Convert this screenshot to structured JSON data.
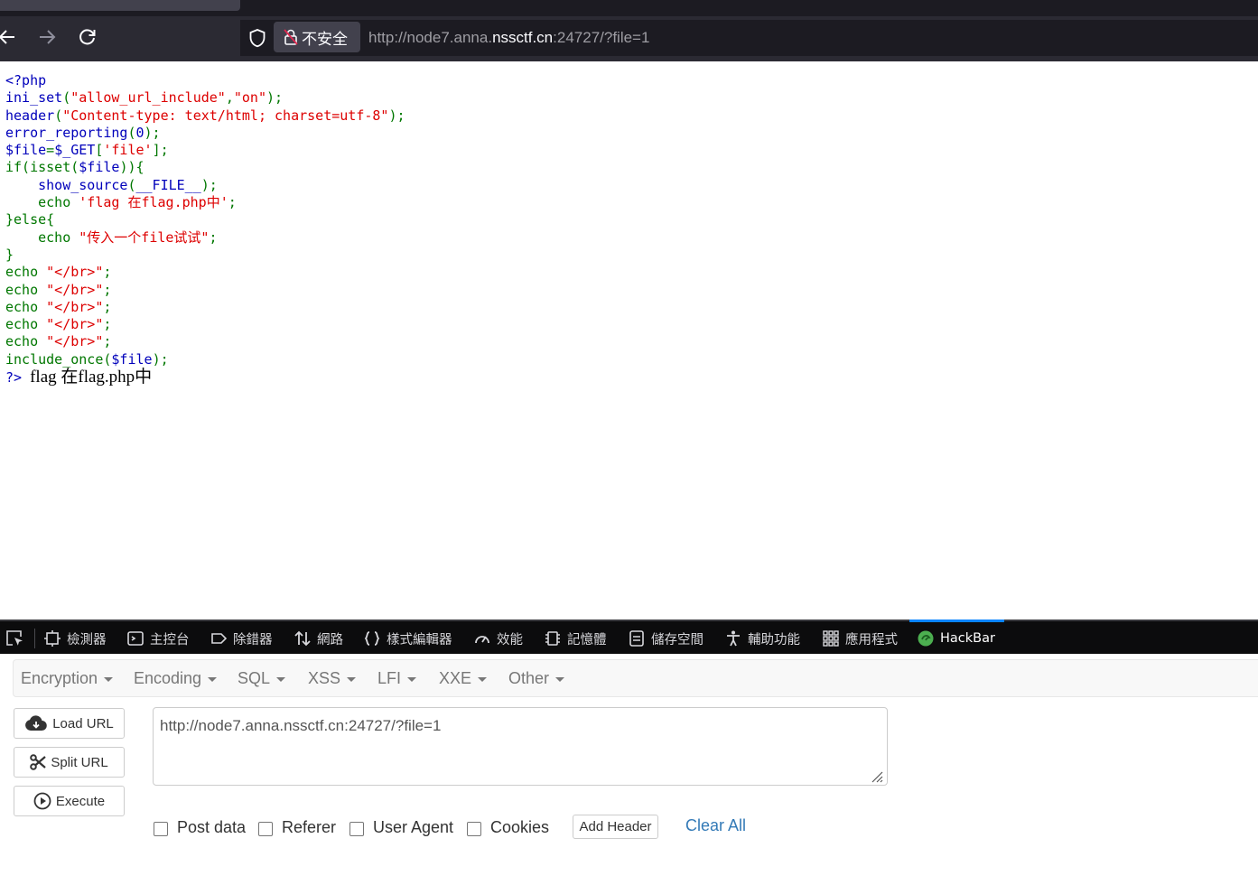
{
  "browser": {
    "security_label": "不安全",
    "url_prefix": "http://node7.anna.",
    "url_host": "nssctf.cn",
    "url_suffix": ":24727/?file=1"
  },
  "source": {
    "lines": [
      [
        {
          "t": "<?php",
          "c": "k"
        }
      ],
      [
        {
          "t": "ini_set",
          "c": "k"
        },
        {
          "t": "(",
          "c": "g"
        },
        {
          "t": "\"allow_url_include\"",
          "c": "r"
        },
        {
          "t": ",",
          "c": "g"
        },
        {
          "t": "\"on\"",
          "c": "r"
        },
        {
          "t": ");",
          "c": "g"
        }
      ],
      [
        {
          "t": "header",
          "c": "k"
        },
        {
          "t": "(",
          "c": "g"
        },
        {
          "t": "\"Content-type: text/html; charset=utf-8\"",
          "c": "r"
        },
        {
          "t": ");",
          "c": "g"
        }
      ],
      [
        {
          "t": "error_reporting",
          "c": "k"
        },
        {
          "t": "(",
          "c": "g"
        },
        {
          "t": "0",
          "c": "k"
        },
        {
          "t": ");",
          "c": "g"
        }
      ],
      [
        {
          "t": "$file",
          "c": "k"
        },
        {
          "t": "=",
          "c": "g"
        },
        {
          "t": "$_GET",
          "c": "k"
        },
        {
          "t": "[",
          "c": "g"
        },
        {
          "t": "'file'",
          "c": "r"
        },
        {
          "t": "];",
          "c": "g"
        }
      ],
      [
        {
          "t": "if(isset(",
          "c": "g"
        },
        {
          "t": "$file",
          "c": "k"
        },
        {
          "t": ")){",
          "c": "g"
        }
      ],
      [
        {
          "t": "    ",
          "c": "g"
        },
        {
          "t": "show_source",
          "c": "k"
        },
        {
          "t": "(",
          "c": "g"
        },
        {
          "t": "__FILE__",
          "c": "k"
        },
        {
          "t": ");",
          "c": "g"
        }
      ],
      [
        {
          "t": "    echo ",
          "c": "g"
        },
        {
          "t": "'flag 在flag.php中'",
          "c": "r"
        },
        {
          "t": ";",
          "c": "g"
        }
      ],
      [
        {
          "t": "}else{",
          "c": "g"
        }
      ],
      [
        {
          "t": "    echo ",
          "c": "g"
        },
        {
          "t": "\"传入一个file试试\"",
          "c": "r"
        },
        {
          "t": ";",
          "c": "g"
        }
      ],
      [
        {
          "t": "}",
          "c": "g"
        }
      ],
      [
        {
          "t": "echo ",
          "c": "g"
        },
        {
          "t": "\"</br>\"",
          "c": "r"
        },
        {
          "t": ";",
          "c": "g"
        }
      ],
      [
        {
          "t": "echo ",
          "c": "g"
        },
        {
          "t": "\"</br>\"",
          "c": "r"
        },
        {
          "t": ";",
          "c": "g"
        }
      ],
      [
        {
          "t": "echo ",
          "c": "g"
        },
        {
          "t": "\"</br>\"",
          "c": "r"
        },
        {
          "t": ";",
          "c": "g"
        }
      ],
      [
        {
          "t": "echo ",
          "c": "g"
        },
        {
          "t": "\"</br>\"",
          "c": "r"
        },
        {
          "t": ";",
          "c": "g"
        }
      ],
      [
        {
          "t": "echo ",
          "c": "g"
        },
        {
          "t": "\"</br>\"",
          "c": "r"
        },
        {
          "t": ";",
          "c": "g"
        }
      ],
      [
        {
          "t": "include_once",
          "c": "g"
        },
        {
          "t": "(",
          "c": "g"
        },
        {
          "t": "$file",
          "c": "k"
        },
        {
          "t": ");",
          "c": "g"
        }
      ]
    ],
    "closing_tag": "?>",
    "output_text": "flag 在flag.php中"
  },
  "devtools": {
    "tabs": [
      {
        "label": "檢測器",
        "icon": "inspector-icon"
      },
      {
        "label": "主控台",
        "icon": "console-icon"
      },
      {
        "label": "除錯器",
        "icon": "debugger-icon"
      },
      {
        "label": "網路",
        "icon": "network-icon"
      },
      {
        "label": "樣式編輯器",
        "icon": "style-editor-icon"
      },
      {
        "label": "效能",
        "icon": "performance-icon"
      },
      {
        "label": "記憶體",
        "icon": "memory-icon"
      },
      {
        "label": "儲存空間",
        "icon": "storage-icon"
      },
      {
        "label": "輔助功能",
        "icon": "accessibility-icon"
      },
      {
        "label": "應用程式",
        "icon": "application-icon"
      },
      {
        "label": "HackBar",
        "icon": "hackbar-icon",
        "active": true
      }
    ],
    "active_accent": "#0a84ff"
  },
  "hackbar": {
    "menus": [
      "Encryption",
      "Encoding",
      "SQL",
      "XSS",
      "LFI",
      "XXE",
      "Other"
    ],
    "buttons": {
      "load": "Load URL",
      "split": "Split URL",
      "execute": "Execute"
    },
    "url_value": "http://node7.anna.nssctf.cn:24727/?file=1",
    "options": [
      "Post data",
      "Referer",
      "User Agent",
      "Cookies"
    ],
    "add_header": "Add Header",
    "clear_all": "Clear All",
    "link_color": "#337ab7"
  }
}
